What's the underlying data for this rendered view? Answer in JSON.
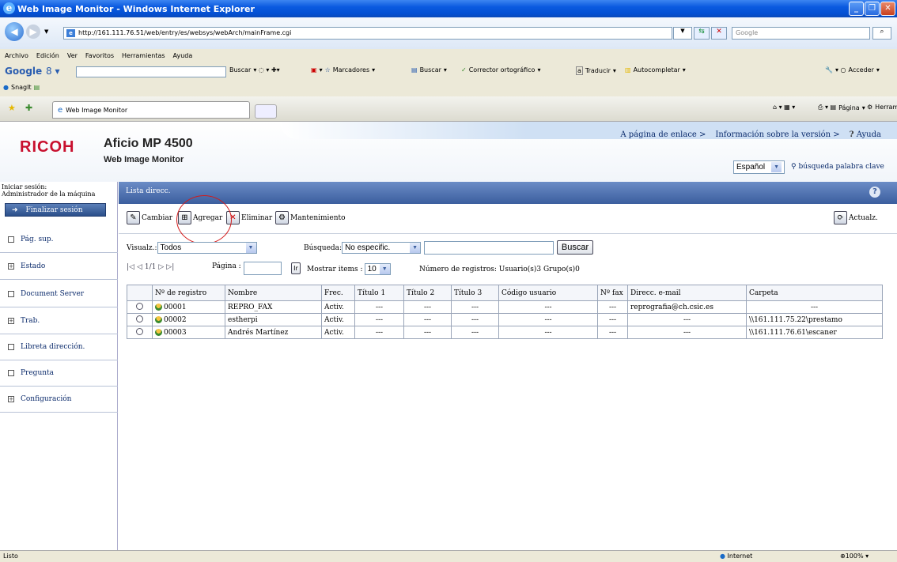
{
  "window": {
    "title": "Web Image Monitor - Windows Internet Explorer"
  },
  "browser": {
    "url": "http://161.111.76.51/web/entry/es/websys/webArch/mainFrame.cgi",
    "search_placeholder": "Google",
    "menu": [
      "Archivo",
      "Edición",
      "Ver",
      "Favoritos",
      "Herramientas",
      "Ayuda"
    ],
    "google_toolbar": {
      "logo": "Google",
      "buscar": "Buscar",
      "marcadores": "Marcadores",
      "buscar2": "Buscar",
      "corrector": "Corrector ortográfico",
      "traducir": "Traducir",
      "autocompletar": "Autocompletar",
      "acceder": "Acceder"
    },
    "snagit": "SnagIt",
    "tab": "Web Image Monitor",
    "cmd": {
      "pagina": "Página",
      "herramientas": "Herramientas"
    }
  },
  "header": {
    "brand": "RICOH",
    "product": "Aficio MP 4500",
    "subtitle": "Web Image Monitor",
    "links": {
      "enlace": "A página de enlace >",
      "version": "Información sobre la versión >",
      "ayuda": "Ayuda"
    },
    "language": "Español",
    "keyword_search": "búsqueda palabra clave"
  },
  "sidebar": {
    "login_label": "Iniciar sesión:",
    "login_user": "Administrador de la máquina",
    "logout": "Finalizar sesión",
    "items": [
      {
        "label": "Pág. sup.",
        "mark": ""
      },
      {
        "label": "Estado",
        "mark": "+"
      },
      {
        "label": "Document Server",
        "mark": ""
      },
      {
        "label": "Trab.",
        "mark": "+"
      },
      {
        "label": "Libreta dirección.",
        "mark": ""
      },
      {
        "label": "Pregunta",
        "mark": ""
      },
      {
        "label": "Configuración",
        "mark": "+"
      }
    ]
  },
  "content": {
    "section_title": "Lista direcc.",
    "toolbar": {
      "cambiar": "Cambiar",
      "agregar": "Agregar",
      "eliminar": "Eliminar",
      "mantenimiento": "Mantenimiento",
      "actualizar": "Actualz."
    },
    "filter": {
      "visualz_label": "Visualz.:",
      "visualz_value": "Todos",
      "busqueda_label": "Búsqueda:",
      "busqueda_value": "No especific.",
      "buscar_button": "Buscar"
    },
    "pager": {
      "page_info": "1/1",
      "pagina_label": "Página :",
      "ir": "Ir",
      "mostrar_label": "Mostrar items :",
      "mostrar_value": "10",
      "registros": "Número de registros: Usuario(s)3  Grupo(s)0"
    },
    "table": {
      "headers": [
        "Nº de registro",
        "Nombre",
        "Frec.",
        "Título 1",
        "Título 2",
        "Título 3",
        "Código usuario",
        "Nº fax",
        "Direcc. e-mail",
        "Carpeta"
      ],
      "rows": [
        {
          "reg": "00001",
          "nombre": "REPRO_FAX",
          "frec": "Activ.",
          "t1": "---",
          "t2": "---",
          "t3": "---",
          "codigo": "---",
          "fax": "---",
          "email": "reprografia@ch.csic.es",
          "carpeta": "---"
        },
        {
          "reg": "00002",
          "nombre": "estherpi",
          "frec": "Activ.",
          "t1": "---",
          "t2": "---",
          "t3": "---",
          "codigo": "---",
          "fax": "---",
          "email": "---",
          "carpeta": "\\\\161.111.75.22\\prestamo"
        },
        {
          "reg": "00003",
          "nombre": "Andrés Martínez",
          "frec": "Activ.",
          "t1": "---",
          "t2": "---",
          "t3": "---",
          "codigo": "---",
          "fax": "---",
          "email": "---",
          "carpeta": "\\\\161.111.76.61\\escaner"
        }
      ]
    }
  },
  "statusbar": {
    "left": "Listo",
    "zone": "Internet",
    "zoom": "100%"
  }
}
